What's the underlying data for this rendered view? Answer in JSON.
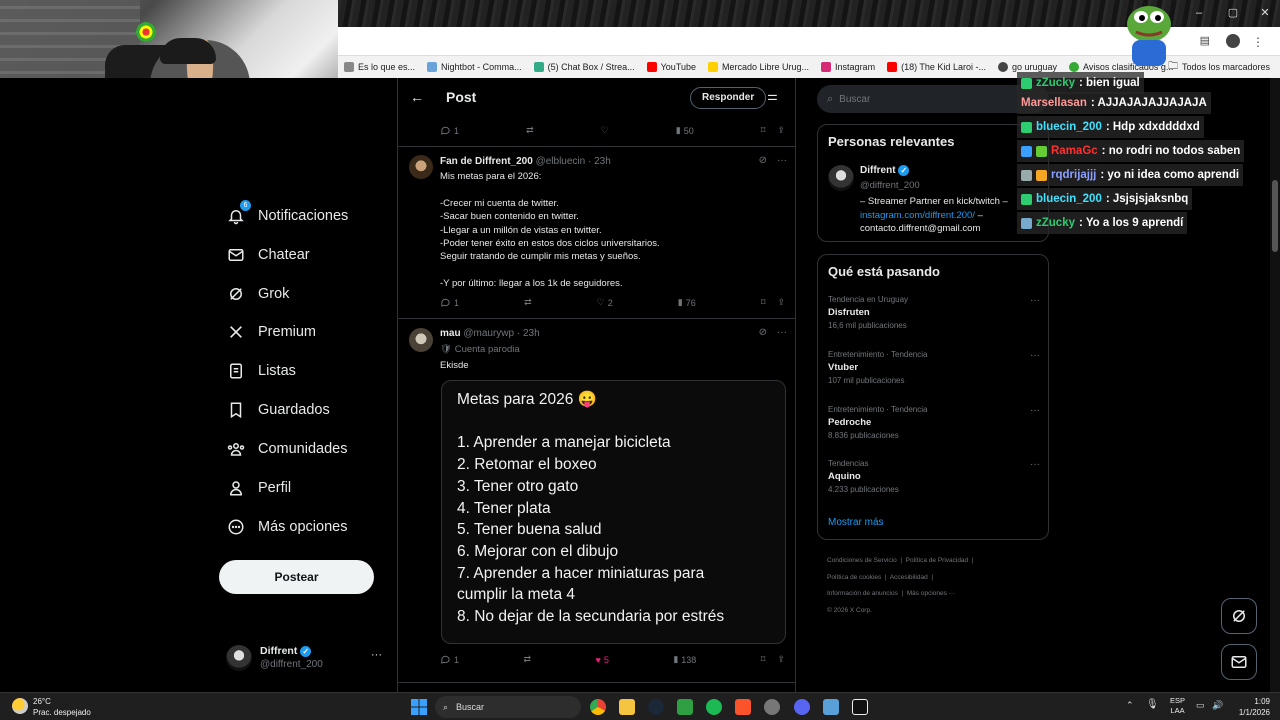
{
  "browser": {
    "bookmarks": [
      {
        "label": "Es lo que es...",
        "color": "#888"
      },
      {
        "label": "Nightbot - Comma...",
        "color": "#6aa3d9"
      },
      {
        "label": "(5) Chat Box / Strea...",
        "color": "#3a8"
      },
      {
        "label": "YouTube",
        "color": "#f00"
      },
      {
        "label": "Mercado Libre Urug...",
        "color": "#ffd000"
      },
      {
        "label": "Instagram",
        "color": "#d62976"
      },
      {
        "label": "(18) The Kid Laroi -...",
        "color": "#f00"
      },
      {
        "label": "go uruguay",
        "color": "#444"
      },
      {
        "label": "Avisos clasificados g...",
        "color": "#3a3"
      }
    ],
    "all_bookmarks": "Todos los marcadores",
    "window_controls": [
      "–",
      "▢",
      "✕"
    ]
  },
  "nav": {
    "items": [
      {
        "label": "Notificaciones",
        "icon": "bell-icon",
        "badge": "6"
      },
      {
        "label": "Chatear",
        "icon": "mail-icon"
      },
      {
        "label": "Grok",
        "icon": "grok-icon"
      },
      {
        "label": "Premium",
        "icon": "x-logo-icon"
      },
      {
        "label": "Listas",
        "icon": "list-icon"
      },
      {
        "label": "Guardados",
        "icon": "bookmark-icon"
      },
      {
        "label": "Comunidades",
        "icon": "communities-icon"
      },
      {
        "label": "Perfil",
        "icon": "person-icon"
      },
      {
        "label": "Más opciones",
        "icon": "more-circle-icon"
      }
    ],
    "post_button": "Postear",
    "account": {
      "name": "Diffrent",
      "handle": "@diffrent_200",
      "more": "···"
    }
  },
  "center": {
    "header_title": "Post",
    "reply_button": "Responder",
    "top_stats": {
      "replies": "1",
      "likes": "",
      "views": "50"
    },
    "tweet1": {
      "name": "Fan de Diffrent_200",
      "handle": "@elbluecin",
      "time": "· 23h",
      "body": "Mis metas para el 2026:\n\n-Crecer mi cuenta de twitter.\n-Sacar buen contenido en twitter.\n-Llegar a un millón de vistas en twitter.\n-Poder tener éxito en estos dos ciclos universitarios.\nSeguir tratando de cumplir mis metas y sueños.\n\n-Y por último: llegar a los 1k de seguidores.",
      "replies": "1",
      "likes": "2",
      "views": "76"
    },
    "tweet2": {
      "name": "mau",
      "handle": "@maurywp",
      "time": "· 23h",
      "parody": "Cuenta parodia",
      "body": "Ekisde",
      "media_lines": [
        "Metas para 2026 😛",
        "",
        "1. Aprender a manejar bicicleta",
        "2. Retomar el boxeo",
        "3. Tener otro gato",
        "4. Tener plata",
        "5. Tener buena salud",
        "6. Mejorar con el dibujo",
        "7. Aprender a hacer miniaturas para",
        "cumplir la meta 4",
        "8. No dejar de la secundaria por estrés"
      ],
      "replies": "1",
      "likes": "5",
      "views": "138"
    }
  },
  "right": {
    "search_placeholder": "Buscar",
    "relevant": {
      "title": "Personas relevantes",
      "name": "Diffrent",
      "handle": "@diffrent_200",
      "bio1": "– Streamer Partner en kick/twitch –",
      "link": "instagram.com/diffrent.200/",
      "bio2": " –",
      "bio3": "contacto.diffrent@gmail.com"
    },
    "trends": {
      "title": "Qué está pasando",
      "items": [
        {
          "cat": "Tendencia en Uruguay",
          "name": "Disfruten",
          "count": "16,6 mil publicaciones"
        },
        {
          "cat": "Entretenimiento · Tendencia",
          "name": "Vtuber",
          "count": "107 mil publicaciones"
        },
        {
          "cat": "Entretenimiento · Tendencia",
          "name": "Pedroche",
          "count": "8.836 publicaciones"
        },
        {
          "cat": "Tendencias",
          "name": "Aquino",
          "count": "4.233 publicaciones"
        }
      ],
      "show_more": "Mostrar más"
    },
    "footer": {
      "line1": [
        "Condiciones de Servicio",
        "Política de Privacidad"
      ],
      "line2": [
        "Política de cookies",
        "Accesibilidad"
      ],
      "line3": [
        "Información de anuncios",
        "Más opciones ···"
      ],
      "copyright": "© 2026 X Corp."
    }
  },
  "chat": [
    {
      "user": "zZucky",
      "msg": ": bien igual",
      "color": "#2ecc71"
    },
    {
      "user": "Marsellasan",
      "msg": ": AJJAJAJAJJAJAJA",
      "color": "#ff9a9a"
    },
    {
      "user": "bluecin_200",
      "msg": ": Hdp xdxddddxd",
      "color": "#3ee3ff"
    },
    {
      "user": "RamaGc",
      "msg": ": no rodri no todos saben",
      "color": "#ff3030"
    },
    {
      "user": "rqdrijajjj",
      "msg": ": yo ni idea como aprendi",
      "color": "#8aa0ff"
    },
    {
      "user": "bluecin_200",
      "msg": ": Jsjsjsjaksnbq",
      "color": "#3ee3ff"
    },
    {
      "user": "zZucky",
      "msg": ": Yo a los 9 aprendí",
      "color": "#2ecc71"
    }
  ],
  "taskbar": {
    "weather_temp": "26°C",
    "weather_desc": "Prac. despejado",
    "search": "Buscar",
    "lang1": "ESP",
    "lang2": "LAA",
    "time": "1:09",
    "date": "1/1/2026"
  },
  "colors": {
    "accent": "#1d9bf0",
    "background": "#000000",
    "border": "#2f3336",
    "like_pink": "#f91880"
  }
}
